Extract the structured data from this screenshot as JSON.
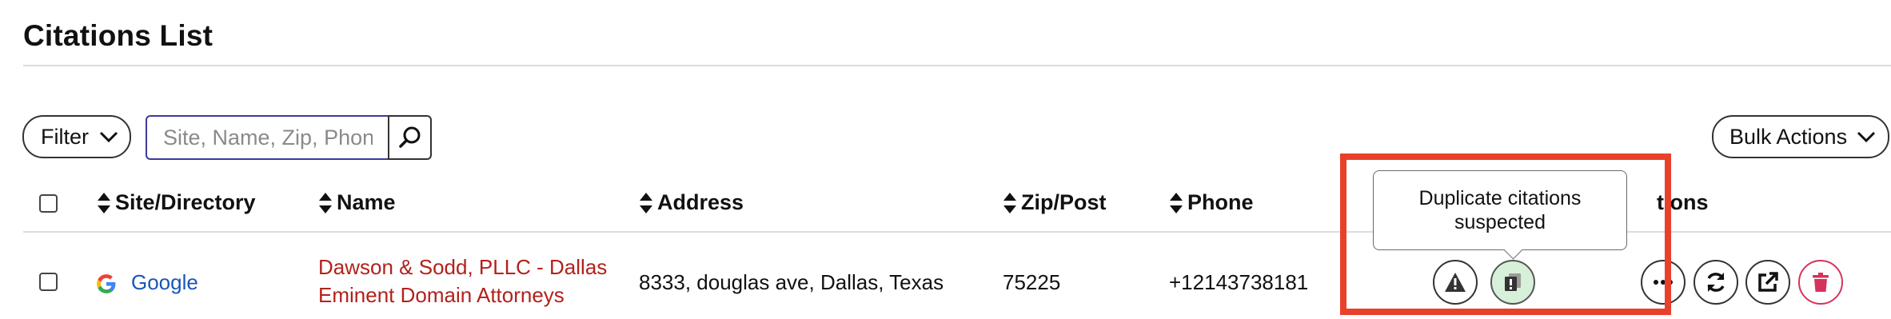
{
  "page": {
    "title": "Citations List"
  },
  "toolbar": {
    "filter_label": "Filter",
    "search_placeholder": "Site, Name, Zip, Phone",
    "bulk_actions_label": "Bulk Actions"
  },
  "table": {
    "columns": {
      "site": "Site/Directory",
      "name": "Name",
      "address": "Address",
      "zip": "Zip/Post",
      "phone": "Phone",
      "actions_partial": "tions"
    },
    "rows": [
      {
        "site": "Google",
        "site_icon": "google-g-icon",
        "name_line1": "Dawson & Sodd, PLLC - Dallas",
        "name_line2": "Eminent Domain Attorneys",
        "address": "8333, douglas ave, Dallas, Texas",
        "zip": "75225",
        "phone": "+12143738181"
      }
    ]
  },
  "tooltip": {
    "line1": "Duplicate citations",
    "line2": "suspected"
  },
  "icons": {
    "filter": "chevron-down-icon",
    "search": "search-icon",
    "sort": "sort-icon",
    "warning": "warning-icon",
    "duplicate": "duplicate-icon",
    "more": "more-icon",
    "refresh": "refresh-icon",
    "external": "external-link-icon",
    "delete": "trash-icon"
  },
  "colors": {
    "highlight": "#e8402a",
    "link_blue": "#1a55b8",
    "link_red": "#b3211c",
    "duplicate_bg": "#d7f0d9",
    "delete_red": "#d6335c",
    "search_border": "#3d3a9c"
  }
}
